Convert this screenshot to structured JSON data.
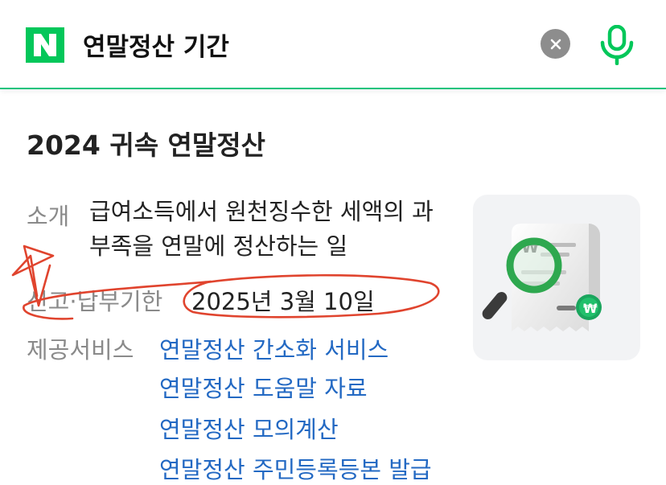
{
  "search": {
    "query": "연말정산 기간"
  },
  "colors": {
    "brand": "#03c75a",
    "underline": "#19c37d",
    "link": "#2369c3",
    "annotation": "#e0442e"
  },
  "icons": {
    "logo": "naver-n-logo",
    "clear": "close-icon",
    "voice": "microphone-icon",
    "thumbnail": "receipt-magnifier-icon"
  },
  "card": {
    "title": "2024 귀속 연말정산",
    "intro": {
      "label": "소개",
      "value": "급여소득에서 원천징수한 세액의 과부족을 연말에 정산하는 일"
    },
    "deadline": {
      "label": "신고·납부기한",
      "value": "2025년 3월 10일"
    },
    "services": {
      "label": "제공서비스",
      "links": [
        "연말정산 간소화 서비스",
        "연말정산 도움말 자료",
        "연말정산 모의계산",
        "연말정산 주민등록등본 발급"
      ]
    }
  }
}
